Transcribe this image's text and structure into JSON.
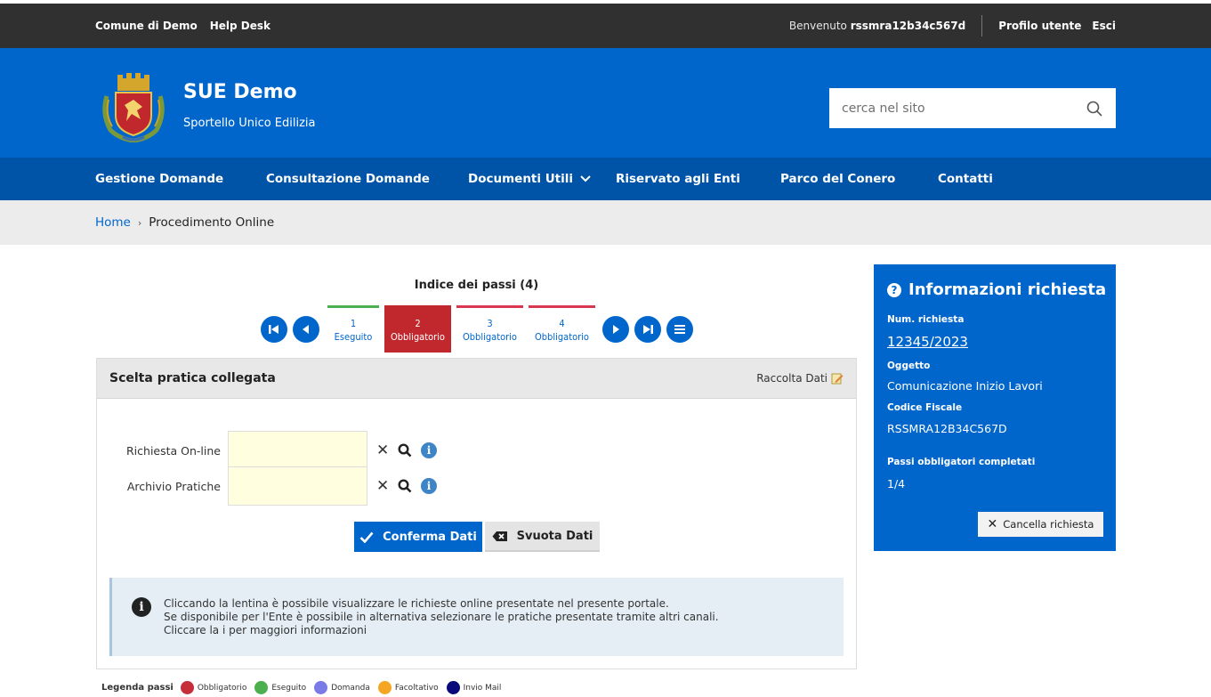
{
  "topbar": {
    "link_comune": "Comune di Demo",
    "link_helpdesk": "Help Desk",
    "welcome_prefix": "Benvenuto",
    "username": "rssmra12b34c567d",
    "profile": "Profilo utente",
    "logout": "Esci"
  },
  "header": {
    "title": "SUE Demo",
    "subtitle": "Sportello Unico Edilizia",
    "search_placeholder": "cerca nel sito"
  },
  "nav": {
    "items": [
      {
        "label": "Gestione Domande"
      },
      {
        "label": "Consultazione Domande"
      },
      {
        "label": "Documenti Utili"
      },
      {
        "label": "Riservato agli Enti"
      },
      {
        "label": "Parco del Conero"
      },
      {
        "label": "Contatti"
      }
    ]
  },
  "breadcrumb": {
    "home": "Home",
    "current": "Procedimento Online"
  },
  "steps": {
    "title": "Indice dei passi (4)",
    "items": [
      {
        "num": "1",
        "label": "Eseguito"
      },
      {
        "num": "2",
        "label": "Obbligatorio"
      },
      {
        "num": "3",
        "label": "Obbligatorio"
      },
      {
        "num": "4",
        "label": "Obbligatorio"
      }
    ]
  },
  "panel": {
    "title": "Scelta pratica collegata",
    "tag": "Raccolta Dati",
    "fields": [
      {
        "label": "Richiesta On-line",
        "value": ""
      },
      {
        "label": "Archivio Pratiche",
        "value": ""
      }
    ],
    "confirm_label": "Conferma Dati",
    "clear_label": "Svuota Dati",
    "info_lines": [
      "Cliccando la lentina è possibile visualizzare le richieste online presentate nel presente portale.",
      "Se disponibile per l'Ente è possibile in alternativa selezionare le pratiche presentate tramite altri canali.",
      "Cliccare la i per maggiori informazioni"
    ]
  },
  "legend": {
    "title": "Legenda passi",
    "items": [
      {
        "label": "Obbligatorio",
        "color": "#c62f3a"
      },
      {
        "label": "Eseguito",
        "color": "#4caf50"
      },
      {
        "label": "Domanda",
        "color": "#7b7be8"
      },
      {
        "label": "Facoltativo",
        "color": "#f5a623"
      },
      {
        "label": "Invio Mail",
        "color": "#0a0a7a"
      }
    ]
  },
  "card": {
    "title": "Informazioni richiesta",
    "num_label": "Num. richiesta",
    "num_value": "12345/2023",
    "oggetto_label": "Oggetto",
    "oggetto_value": "Comunicazione Inizio Lavori",
    "cf_label": "Codice Fiscale",
    "cf_value": "RSSMRA12B34C567D",
    "passi_label": "Passi obbligatori completati",
    "passi_value": "1/4",
    "cancel_label": "Cancella richiesta"
  },
  "colors": {
    "brand": "#0066cc",
    "nav": "#0054a8",
    "topbar": "#303030",
    "step_active": "#c0282e"
  }
}
